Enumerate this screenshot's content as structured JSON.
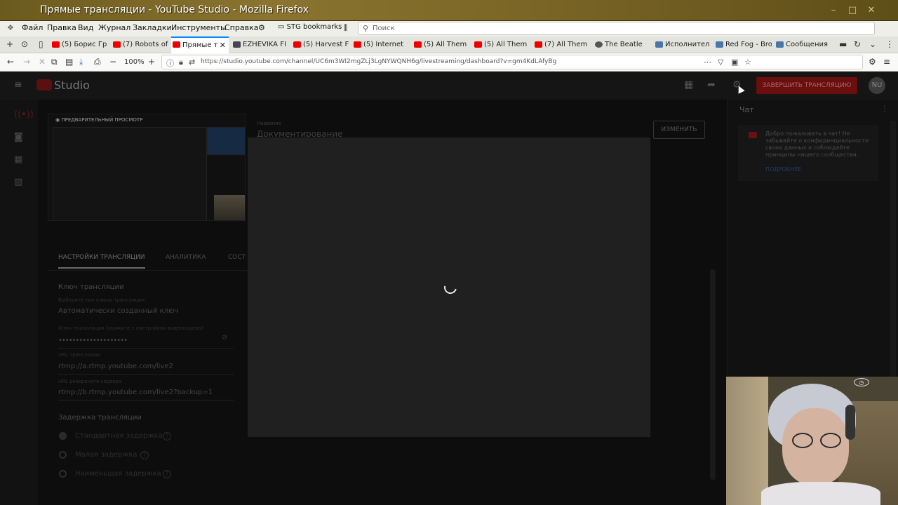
{
  "window": {
    "title": "Прямые трансляции - YouTube Studio - Mozilla Firefox",
    "minimize": "–",
    "maximize": "□",
    "close": "✕"
  },
  "menubar": {
    "items": [
      "Файл",
      "Правка",
      "Вид",
      "Журнал",
      "Закладки",
      "Инструменты",
      "Справка"
    ],
    "bookmarks_label": "STG bookmarks",
    "search_placeholder": "Поиск"
  },
  "tabs": [
    {
      "label": "(5) Борис Гр",
      "favicon": "youtube"
    },
    {
      "label": "(7) Robots of",
      "favicon": "youtube"
    },
    {
      "label": "Прямые т",
      "favicon": "youtube",
      "active": true
    },
    {
      "label": "EZHEVIKA FI",
      "favicon": "shield"
    },
    {
      "label": "(5) Harvest F",
      "favicon": "youtube"
    },
    {
      "label": "(5) Internet",
      "favicon": "youtube"
    },
    {
      "label": "(5) All Them",
      "favicon": "youtube"
    },
    {
      "label": "(5) All Them",
      "favicon": "youtube"
    },
    {
      "label": "(7) All Them",
      "favicon": "youtube"
    },
    {
      "label": "The Beatle",
      "favicon": "music"
    },
    {
      "label": "Исполнител",
      "favicon": "vk"
    },
    {
      "label": "Red Fog - Bro",
      "favicon": "vk"
    },
    {
      "label": "Сообщения",
      "favicon": "messages"
    }
  ],
  "navbar": {
    "zoom": "100%",
    "url": "https://studio.youtube.com/channel/UC6m3WI2mgZLj3LgNYWQNH6g/livestreaming/dashboard?v=gm4KdLAfyBg"
  },
  "studio": {
    "brand": "Studio",
    "end_stream_button": "ЗАВЕРШИТЬ ТРАНСЛЯЦИЮ",
    "avatar_initials": "NU"
  },
  "preview": {
    "badge": "ПРЕДВАРИТЕЛЬНЫЙ ПРОСМОТР"
  },
  "stream": {
    "name_label": "Название",
    "name_value": "Документирование",
    "edit_button": "ИЗМЕНИТЬ"
  },
  "settings_tabs": [
    "НАСТРОЙКИ ТРАНСЛЯЦИИ",
    "АНАЛИТИКА",
    "СОСТ"
  ],
  "stream_key": {
    "section_title": "Ключ трансляции",
    "key_type_label": "Выберите тип ключа трансляции",
    "key_type_value": "Автоматически созданный ключ",
    "key_label": "Ключ трансляции (укажите с настройках видеокодера)",
    "key_value": "••••••••••••••••••••",
    "url_label": "URL трансляции",
    "url_value": "rtmp://a.rtmp.youtube.com/live2",
    "backup_label": "URL резервного сервера",
    "backup_value": "rtmp://b.rtmp.youtube.com/live2?backup=1"
  },
  "latency": {
    "section_title": "Задержка трансляции",
    "options": [
      "Стандартная задержка",
      "Малая задержка",
      "Наименьшая задержка"
    ]
  },
  "chat": {
    "title": "Чат",
    "message": "Добро пожаловать в чат! Не забывайте о конфиденциальности своих данных и соблюдайте принципы нашего сообщества.",
    "link": "ПОДРОБНЕЕ"
  },
  "colors": {
    "youtube_red": "#ff0000",
    "firefox_accent": "#0a84ff"
  }
}
